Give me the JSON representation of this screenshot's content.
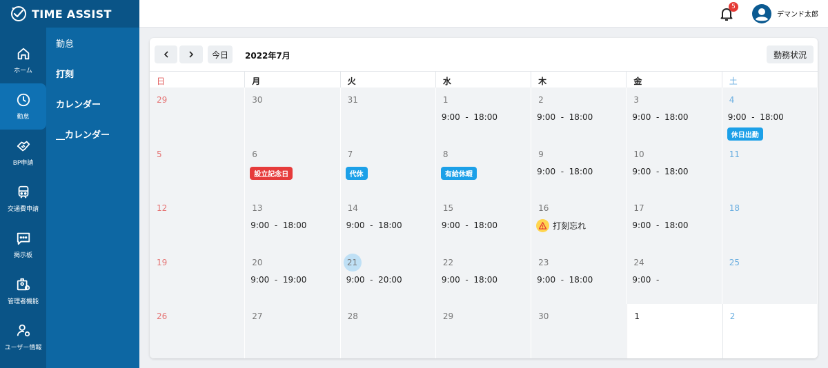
{
  "brand": {
    "name": "TIME ASSIST"
  },
  "rail": [
    {
      "label": "ホーム",
      "icon": "home-icon"
    },
    {
      "label": "勤怠",
      "icon": "clock-icon",
      "active": true
    },
    {
      "label": "BP申請",
      "icon": "handshake-icon"
    },
    {
      "label": "交通費申請",
      "icon": "train-icon"
    },
    {
      "label": "掲示板",
      "icon": "message-icon"
    },
    {
      "label": "管理者機能",
      "icon": "admin-icon"
    },
    {
      "label": "ユーザー情報",
      "icon": "user-settings-icon"
    }
  ],
  "subnav": {
    "header": "勤怠",
    "items": [
      "打刻",
      "カレンダー",
      "__カレンダー"
    ]
  },
  "topbar": {
    "notification_count": "5",
    "username": "デマンド太郎"
  },
  "calendar": {
    "prev_label": "<",
    "next_label": ">",
    "today_label": "今日",
    "month_label": "2022年7月",
    "status_button": "勤務状況",
    "weekdays": [
      "日",
      "月",
      "火",
      "水",
      "木",
      "金",
      "土"
    ],
    "weeks": [
      [
        {
          "day": "29",
          "dim": true
        },
        {
          "day": "30",
          "dim": true
        },
        {
          "day": "31",
          "dim": true
        },
        {
          "day": "1",
          "shift": "9:00  -  18:00"
        },
        {
          "day": "2",
          "shift": "9:00  -  18:00"
        },
        {
          "day": "3",
          "shift": "9:00  -  18:00"
        },
        {
          "day": "4",
          "shift": "9:00  -  18:00",
          "badge": "休日出勤",
          "badge_color": "blue"
        }
      ],
      [
        {
          "day": "5"
        },
        {
          "day": "6",
          "badge": "設立記念日",
          "badge_color": "red"
        },
        {
          "day": "7",
          "badge": "代休",
          "badge_color": "blue"
        },
        {
          "day": "8",
          "badge": "有給休暇",
          "badge_color": "blue"
        },
        {
          "day": "9",
          "shift": "9:00  -  18:00"
        },
        {
          "day": "10",
          "shift": "9:00  -  18:00"
        },
        {
          "day": "11"
        }
      ],
      [
        {
          "day": "12"
        },
        {
          "day": "13",
          "shift": "9:00  -  18:00"
        },
        {
          "day": "14",
          "shift": "9:00  -  18:00"
        },
        {
          "day": "15",
          "shift": "9:00  -  18:00"
        },
        {
          "day": "16",
          "warning": "打刻忘れ"
        },
        {
          "day": "17",
          "shift": "9:00  -  18:00"
        },
        {
          "day": "18"
        }
      ],
      [
        {
          "day": "19"
        },
        {
          "day": "20",
          "shift": "9:00  -  19:00"
        },
        {
          "day": "21",
          "shift": "9:00  -  20:00",
          "today": true
        },
        {
          "day": "22",
          "shift": "9:00  -  18:00"
        },
        {
          "day": "23",
          "shift": "9:00  -  18:00"
        },
        {
          "day": "24",
          "shift": "9:00  -"
        },
        {
          "day": "25"
        }
      ],
      [
        {
          "day": "26"
        },
        {
          "day": "27"
        },
        {
          "day": "28"
        },
        {
          "day": "29"
        },
        {
          "day": "30"
        },
        {
          "day": "1",
          "next_month": true
        },
        {
          "day": "2",
          "next_month": true
        }
      ]
    ]
  },
  "colors": {
    "rail_bg": "#0a5487",
    "subnav_bg": "#0d67a3",
    "sunday": "#e57373",
    "saturday": "#6aaee0",
    "badge_red": "#e63b3b",
    "badge_blue": "#1ca0e8"
  }
}
